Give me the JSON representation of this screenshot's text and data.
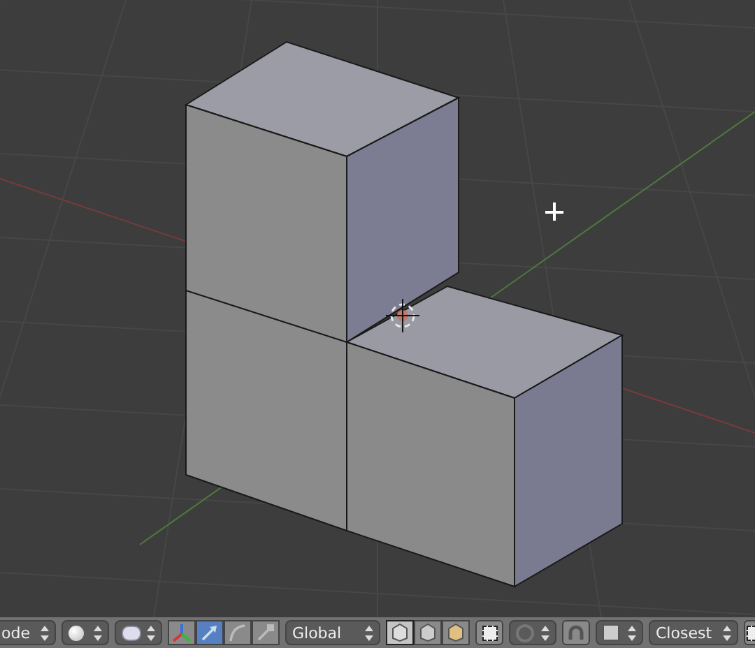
{
  "header": {
    "mode": "ode",
    "manipulators": [
      {
        "kind": "axes",
        "selected": false
      },
      {
        "kind": "translate",
        "selected": true
      },
      {
        "kind": "rotate",
        "selected": false
      },
      {
        "kind": "scale",
        "selected": false
      }
    ],
    "orientation": "Global",
    "select_modes": [
      {
        "kind": "vertex",
        "selected": true
      },
      {
        "kind": "edge",
        "selected": false
      },
      {
        "kind": "face",
        "selected": false
      }
    ],
    "snap": {
      "on": false
    },
    "snap_target": "Closest"
  }
}
